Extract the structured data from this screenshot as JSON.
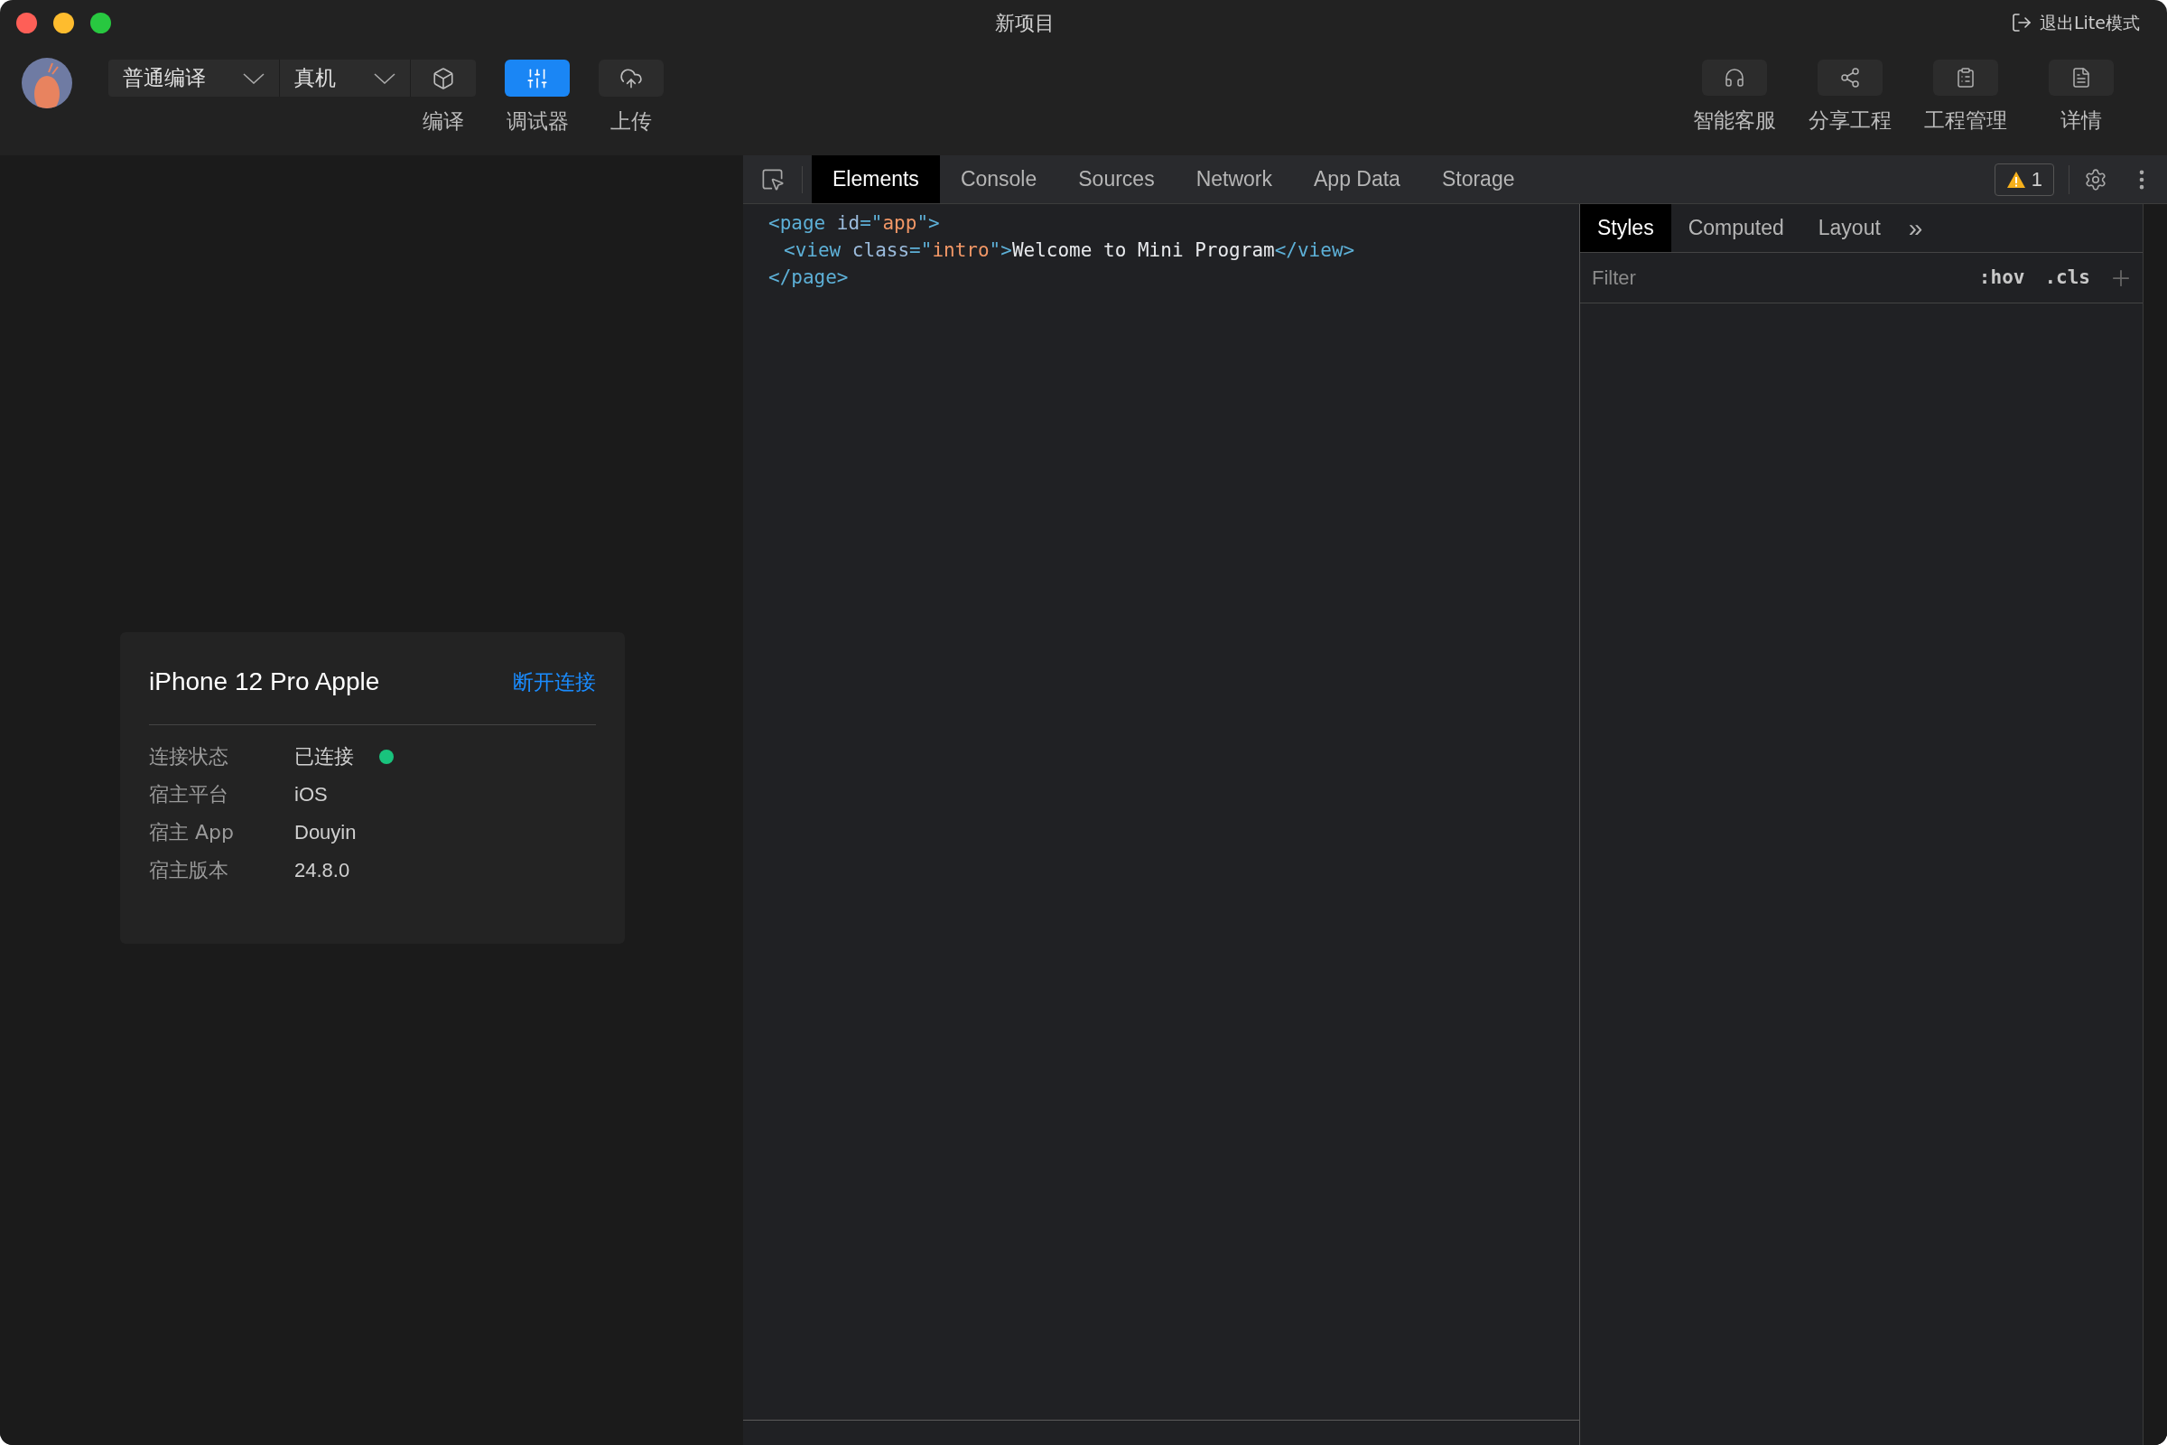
{
  "window": {
    "title": "新项目",
    "exit_lite": "退出Lite模式"
  },
  "toolbar": {
    "dropdowns": [
      {
        "label": "普通编译"
      },
      {
        "label": "真机"
      }
    ],
    "left_buttons": [
      {
        "label": "编译",
        "selected": false
      },
      {
        "label": "调试器",
        "selected": true
      },
      {
        "label": "上传",
        "selected": false
      }
    ],
    "right_buttons": [
      {
        "label": "智能客服"
      },
      {
        "label": "分享工程"
      },
      {
        "label": "工程管理"
      },
      {
        "label": "详情"
      }
    ]
  },
  "device_card": {
    "title": "iPhone 12 Pro Apple",
    "action": "断开连接",
    "status": {
      "label": "连接状态",
      "value": "已连接",
      "connected": true
    },
    "details": [
      {
        "label": "宿主平台",
        "value": "iOS"
      },
      {
        "label": "宿主 App",
        "value": "Douyin"
      },
      {
        "label": "宿主版本",
        "value": "24.8.0"
      }
    ]
  },
  "devtools": {
    "tabs": [
      {
        "label": "Elements",
        "selected": true
      },
      {
        "label": "Console",
        "selected": false
      },
      {
        "label": "Sources",
        "selected": false
      },
      {
        "label": "Network",
        "selected": false
      },
      {
        "label": "App Data",
        "selected": false
      },
      {
        "label": "Storage",
        "selected": false
      }
    ],
    "warnings": "1",
    "dom": [
      {
        "open": [
          {
            "kind": "tag",
            "text": "<page"
          },
          {
            "kind": "attr",
            "text": " id"
          },
          {
            "kind": "tag",
            "text": "=\""
          },
          {
            "kind": "string",
            "text": "app"
          },
          {
            "kind": "tag",
            "text": "\">"
          }
        ],
        "children": [
          {
            "open": [
              {
                "kind": "tag",
                "text": "<view"
              },
              {
                "kind": "attr",
                "text": " class"
              },
              {
                "kind": "tag",
                "text": "=\""
              },
              {
                "kind": "string",
                "text": "intro"
              },
              {
                "kind": "tag",
                "text": "\">"
              },
              {
                "kind": "text",
                "text": "Welcome to Mini Program"
              },
              {
                "kind": "tag",
                "text": "</view>"
              }
            ]
          }
        ],
        "close": [
          {
            "kind": "tag",
            "text": "</page>"
          }
        ]
      }
    ],
    "side_tabs": [
      {
        "label": "Styles",
        "selected": true
      },
      {
        "label": "Computed",
        "selected": false
      },
      {
        "label": "Layout",
        "selected": false
      }
    ],
    "more_tabs": "»",
    "filter": {
      "placeholder": "Filter"
    },
    "hov": ":hov",
    "cls": ".cls"
  }
}
